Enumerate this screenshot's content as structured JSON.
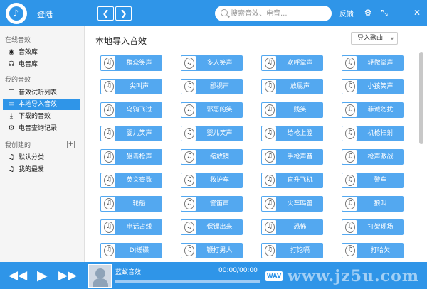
{
  "titlebar": {
    "login": "登陆",
    "back_icon": "chevron-left-icon",
    "forward_icon": "chevron-right-icon",
    "search_placeholder": "搜索音效、电音...",
    "feedback": "反馈",
    "accent": "#2f95e8"
  },
  "sidebar": {
    "online_section": "在线音效",
    "online_items": [
      {
        "label": "音效库",
        "icon": "disc-icon"
      },
      {
        "label": "电音库",
        "icon": "headphones-icon"
      }
    ],
    "my_section": "我的音效",
    "my_items": [
      {
        "label": "音效试听列表",
        "icon": "list-icon"
      },
      {
        "label": "本地导入音效",
        "icon": "monitor-icon"
      },
      {
        "label": "下载的音效",
        "icon": "download-icon"
      },
      {
        "label": "电音查询记录",
        "icon": "gear-icon"
      }
    ],
    "created_section": "我创建的",
    "created_items": [
      {
        "label": "默认分类",
        "icon": "music-note-icon"
      },
      {
        "label": "我的最爱",
        "icon": "music-note-icon"
      }
    ]
  },
  "main": {
    "title": "本地导入音效",
    "import_button": "导入歌曲",
    "rows": [
      [
        "群众笑声",
        "多人笑声",
        "欢呼掌声",
        "轻微掌声"
      ],
      [
        "尖叫声",
        "鄙视声",
        "放屁声",
        "小孩笑声"
      ],
      [
        "乌鸦飞过",
        "邪恶的笑",
        "贱笑",
        "菲诚勿扰"
      ],
      [
        "婴儿笑声",
        "婴儿笑声",
        "给枪上膛",
        "机枪扫射"
      ],
      [
        "狙击枪声",
        "缩放镜",
        "手枪声音",
        "枪声激战"
      ],
      [
        "英文查数",
        "救护车",
        "直升飞机",
        "警车"
      ],
      [
        "轮船",
        "警笛声",
        "火车鸣笛",
        "狼叫"
      ],
      [
        "电话占线",
        "保镖出来",
        "恐怖",
        "打架现场"
      ],
      [
        "DJ搓碟",
        "鞭打男人",
        "打饱嗝",
        "打哈欠"
      ]
    ]
  },
  "player": {
    "song": "蓝蚁音效",
    "time": "00:00/00:00",
    "format": "WAV",
    "watermark": "www.jz5u.com"
  }
}
